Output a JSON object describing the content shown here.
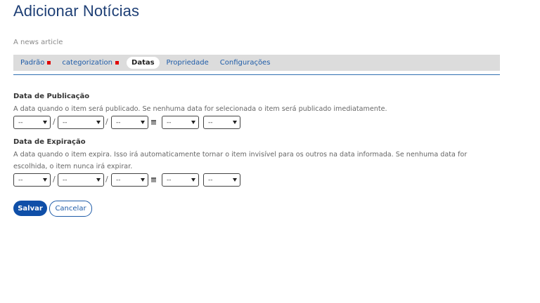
{
  "page": {
    "title": "Adicionar Notícias",
    "description": "A news article"
  },
  "tabs": [
    {
      "label": "Padrão",
      "required": true,
      "active": false
    },
    {
      "label": "categorization",
      "required": true,
      "active": false
    },
    {
      "label": "Datas",
      "required": false,
      "active": true
    },
    {
      "label": "Propriedade",
      "required": false,
      "active": false
    },
    {
      "label": "Configurações",
      "required": false,
      "active": false
    }
  ],
  "publication": {
    "label": "Data de Publicação",
    "help": "A data quando o item será publicado. Se nenhuma data for selecionada o item será publicado imediatamente.",
    "fields": {
      "day": "--",
      "month": "--",
      "year": "--",
      "hour": "--",
      "minute": "--"
    }
  },
  "expiration": {
    "label": "Data de Expiração",
    "help": "A data quando o item expira. Isso irá automaticamente tornar o item invisível para os outros na data informada. Se nenhuma data for escolhida, o item nunca irá expirar.",
    "fields": {
      "day": "--",
      "month": "--",
      "year": "--",
      "hour": "--",
      "minute": "--"
    }
  },
  "separator": "/",
  "icons": {
    "calendar": "calendar-icon",
    "dropdown": "chevron-down-icon"
  },
  "buttons": {
    "save": "Salvar",
    "cancel": "Cancelar"
  },
  "colors": {
    "title": "#1e3f75",
    "link": "#1f5ca8",
    "primary_button": "#0f4fa8",
    "required_marker": "#e00000",
    "tab_bar": "#dcdcdc"
  }
}
